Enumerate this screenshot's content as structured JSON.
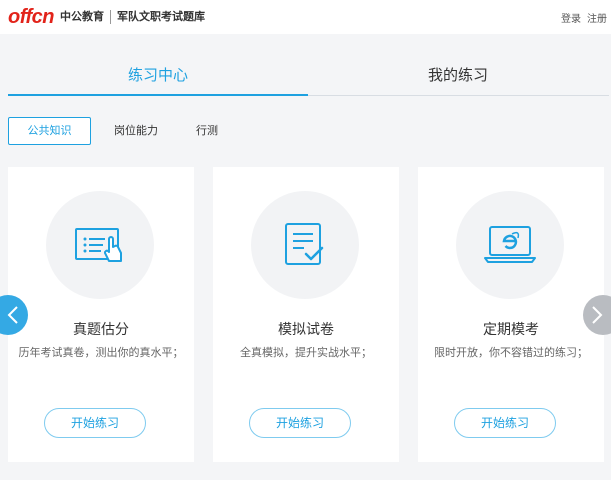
{
  "brand": {
    "logo": "offcn",
    "name": "中公教育",
    "subtitle": "军队文职考试题库"
  },
  "auth": {
    "login": "登录",
    "register": "注册"
  },
  "tabs": [
    {
      "label": "练习中心",
      "active": true
    },
    {
      "label": "我的练习",
      "active": false
    }
  ],
  "subtabs": [
    {
      "label": "公共知识",
      "active": true
    },
    {
      "label": "岗位能力",
      "active": false
    },
    {
      "label": "行测",
      "active": false
    }
  ],
  "cards": [
    {
      "title": "真题估分",
      "desc": "历年考试真卷，测出你的真水平；",
      "button": "开始练习",
      "icon": "touch-list-icon"
    },
    {
      "title": "模拟试卷",
      "desc": "全真模拟，提升实战水平；",
      "button": "开始练习",
      "icon": "checklist-icon"
    },
    {
      "title": "定期模考",
      "desc": "限时开放，你不容错过的练习；",
      "button": "开始练习",
      "icon": "laptop-browser-icon"
    }
  ],
  "colors": {
    "accent": "#1ea1e0",
    "brand_red": "#e2231a",
    "arrow_active": "#34a9e4",
    "arrow_inactive": "#b9bcc1"
  }
}
